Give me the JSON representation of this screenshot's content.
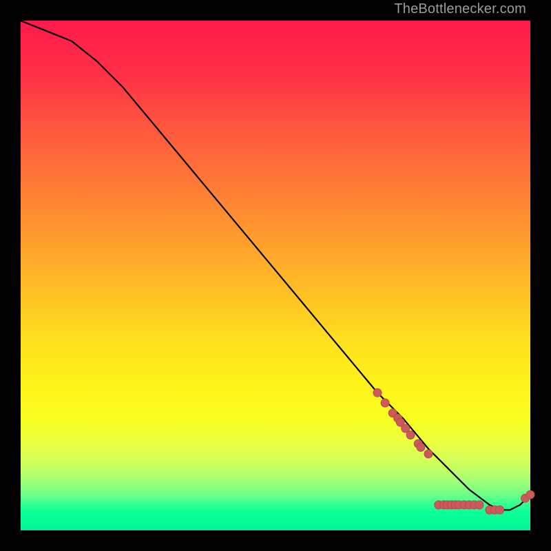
{
  "attribution": "TheBottlenecker.com",
  "colors": {
    "background": "#000000",
    "text": "#9c9c9c",
    "curve": "#000000",
    "marker": "#cc5a5a",
    "marker_stroke": "#b44c4c"
  },
  "chart_data": {
    "type": "line",
    "title": "",
    "xlabel": "",
    "ylabel": "",
    "xlim": [
      0,
      100
    ],
    "ylim": [
      0,
      100
    ],
    "grid": false,
    "legend": false,
    "series": [
      {
        "name": "bottleneck-curve",
        "x": [
          0,
          5,
          10,
          15,
          20,
          25,
          30,
          35,
          40,
          45,
          50,
          55,
          60,
          65,
          70,
          75,
          80,
          82,
          84,
          86,
          88,
          90,
          92,
          94,
          96,
          98,
          100
        ],
        "y": [
          100,
          98,
          96,
          92,
          87,
          81,
          75,
          69,
          63,
          57,
          51,
          45,
          39,
          33,
          27,
          22,
          16,
          14,
          12,
          10,
          8,
          6.5,
          5,
          4,
          4,
          5,
          7
        ]
      }
    ],
    "markers": {
      "name": "highlight-points",
      "points": [
        {
          "x": 70,
          "y": 27
        },
        {
          "x": 71.5,
          "y": 25
        },
        {
          "x": 73,
          "y": 23
        },
        {
          "x": 74,
          "y": 22
        },
        {
          "x": 74.5,
          "y": 21.2
        },
        {
          "x": 75.5,
          "y": 20
        },
        {
          "x": 76.5,
          "y": 18.7
        },
        {
          "x": 78,
          "y": 17
        },
        {
          "x": 78.5,
          "y": 16.3
        },
        {
          "x": 80,
          "y": 15
        },
        {
          "x": 82,
          "y": 5
        },
        {
          "x": 83,
          "y": 5
        },
        {
          "x": 83.7,
          "y": 5
        },
        {
          "x": 84.5,
          "y": 5
        },
        {
          "x": 85.3,
          "y": 5
        },
        {
          "x": 86,
          "y": 5
        },
        {
          "x": 87,
          "y": 5
        },
        {
          "x": 88,
          "y": 5
        },
        {
          "x": 89,
          "y": 5
        },
        {
          "x": 90,
          "y": 5
        },
        {
          "x": 92,
          "y": 4
        },
        {
          "x": 93,
          "y": 4
        },
        {
          "x": 94,
          "y": 4
        },
        {
          "x": 99,
          "y": 6.3
        },
        {
          "x": 100,
          "y": 7
        }
      ]
    }
  }
}
